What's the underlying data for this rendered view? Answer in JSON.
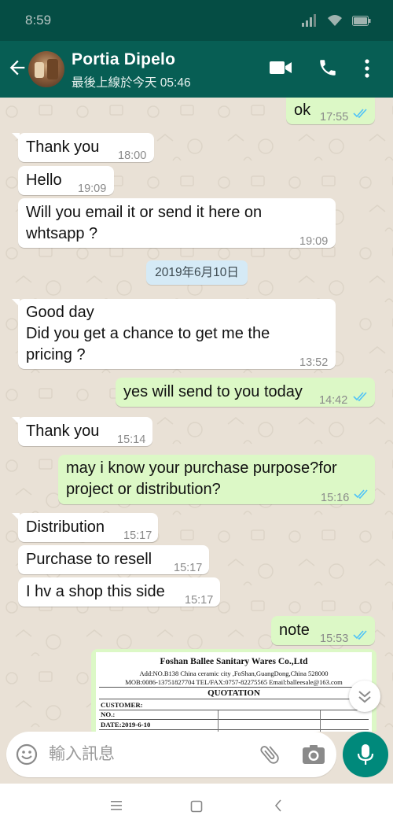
{
  "status_bar": {
    "time": "8:59"
  },
  "header": {
    "contact_name": "Portia Dipelo",
    "last_seen": "最後上線於今天 05:46"
  },
  "messages": [
    {
      "direction": "out",
      "text": "ok",
      "time": "17:55",
      "read": true
    },
    {
      "direction": "in",
      "text": "Thank you",
      "time": "18:00"
    },
    {
      "direction": "in",
      "text": "Hello",
      "time": "19:09"
    },
    {
      "direction": "in",
      "line1": "Will you email it or send it here on",
      "line2": "whtsapp ?",
      "time": "19:09"
    },
    {
      "direction": "in",
      "line1": "Good day",
      "line2": "Did you get a chance to get me the",
      "line3": "pricing ?",
      "time": "13:52"
    },
    {
      "direction": "out",
      "text": "yes will send to you today",
      "time": "14:42",
      "read": true
    },
    {
      "direction": "in",
      "text": "Thank you",
      "time": "15:14"
    },
    {
      "direction": "out",
      "line1": "may i know your purchase purpose?for",
      "line2": "project or distribution?",
      "time": "15:16",
      "read": true
    },
    {
      "direction": "in",
      "text": "Distribution",
      "time": "15:17"
    },
    {
      "direction": "in",
      "text": "Purchase to resell",
      "time": "15:17"
    },
    {
      "direction": "in",
      "text": "I hv a shop this side",
      "time": "15:17"
    },
    {
      "direction": "out",
      "text": "note",
      "time": "15:53",
      "read": true
    }
  ],
  "date_divider": "2019年6月10日",
  "document_image": {
    "company": "Foshan Ballee Sanitary Wares Co.,Ltd",
    "address": "Add:NO.B138 China ceramic city ,FoShan,GuangDong,China 528000",
    "contact": "MOB:0086-13751827704  TEL/FAX:0757-82275565  Email:balleesale@163.com",
    "heading": "QUOTATION",
    "customer_label": "CUSTOMER:",
    "no_label": "NO.:",
    "date_label": "DATE:2019-6-10"
  },
  "composer": {
    "placeholder": "輸入訊息"
  },
  "colors": {
    "header": "#075e54",
    "status_bar": "#054d44",
    "outgoing_bubble": "#dcf8c6",
    "incoming_bubble": "#ffffff",
    "read_ticks": "#4fc3f7",
    "mic_button": "#00897b",
    "date_chip": "#d5eaf6",
    "chat_background": "#e9e1d6"
  },
  "icons": [
    "signal-icon",
    "wifi-icon",
    "battery-icon",
    "back-arrow-icon",
    "video-call-icon",
    "phone-icon",
    "more-options-icon",
    "emoji-icon",
    "attach-icon",
    "camera-icon",
    "mic-icon",
    "scroll-down-icon",
    "nav-menu-icon",
    "nav-home-icon",
    "nav-back-icon"
  ]
}
